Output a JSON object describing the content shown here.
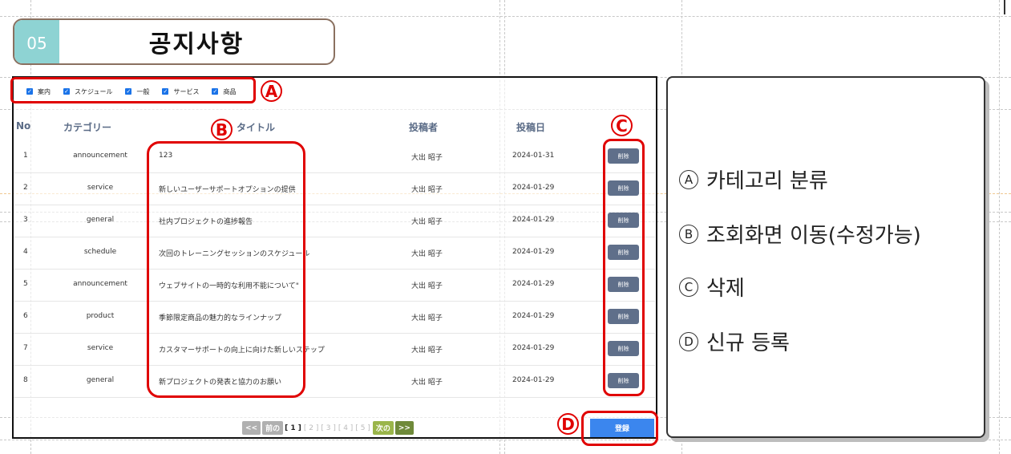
{
  "header": {
    "section_number": "05",
    "title": "공지사항"
  },
  "filters": [
    "案内",
    "スケジュール",
    "一般",
    "サービス",
    "商品"
  ],
  "table": {
    "headers": {
      "no": "No",
      "category": "カテゴリー",
      "title": "タイトル",
      "author": "投稿者",
      "date": "投稿日"
    },
    "rows": [
      {
        "no": "1",
        "category": "announcement",
        "title": "123",
        "author": "大出 昭子",
        "date": "2024-01-31"
      },
      {
        "no": "2",
        "category": "service",
        "title": "新しいユーザーサポートオプションの提供",
        "author": "大出 昭子",
        "date": "2024-01-29"
      },
      {
        "no": "3",
        "category": "general",
        "title": "社内プロジェクトの進捗報告",
        "author": "大出 昭子",
        "date": "2024-01-29"
      },
      {
        "no": "4",
        "category": "schedule",
        "title": "次回のトレーニングセッションのスケジュール",
        "author": "大出 昭子",
        "date": "2024-01-29"
      },
      {
        "no": "5",
        "category": "announcement",
        "title": "ウェブサイトの一時的な利用不能について\"",
        "author": "大出 昭子",
        "date": "2024-01-29"
      },
      {
        "no": "6",
        "category": "product",
        "title": "季節限定商品の魅力的なラインナップ",
        "author": "大出 昭子",
        "date": "2024-01-29"
      },
      {
        "no": "7",
        "category": "service",
        "title": "カスタマーサポートの向上に向けた新しいステップ",
        "author": "大出 昭子",
        "date": "2024-01-29"
      },
      {
        "no": "8",
        "category": "general",
        "title": "新プロジェクトの発表と協力のお願い",
        "author": "大出 昭子",
        "date": "2024-01-29"
      }
    ],
    "delete_label": "削除"
  },
  "pagination": {
    "first": "<<",
    "prev": "前の",
    "pages": [
      "[ 1 ]",
      "[ 2 ]",
      "[ 3 ]",
      "[ 4 ]",
      "[ 5 ]"
    ],
    "next": "次の",
    "last": ">>"
  },
  "register_label": "登録",
  "annotations": {
    "a": "A",
    "b": "B",
    "c": "C",
    "d": "D"
  },
  "legend": [
    {
      "badge": "A",
      "text": "카테고리 분류"
    },
    {
      "badge": "B",
      "text": "조회화면 이동(수정가능)"
    },
    {
      "badge": "C",
      "text": "삭제"
    },
    {
      "badge": "D",
      "text": "신규 등록"
    }
  ],
  "colors": {
    "accent_teal": "#8ed3d3",
    "delete_button": "#5f6f8a",
    "register_button": "#3b86ee",
    "annotation_red": "#e00000",
    "page_next": "#88a04a"
  }
}
